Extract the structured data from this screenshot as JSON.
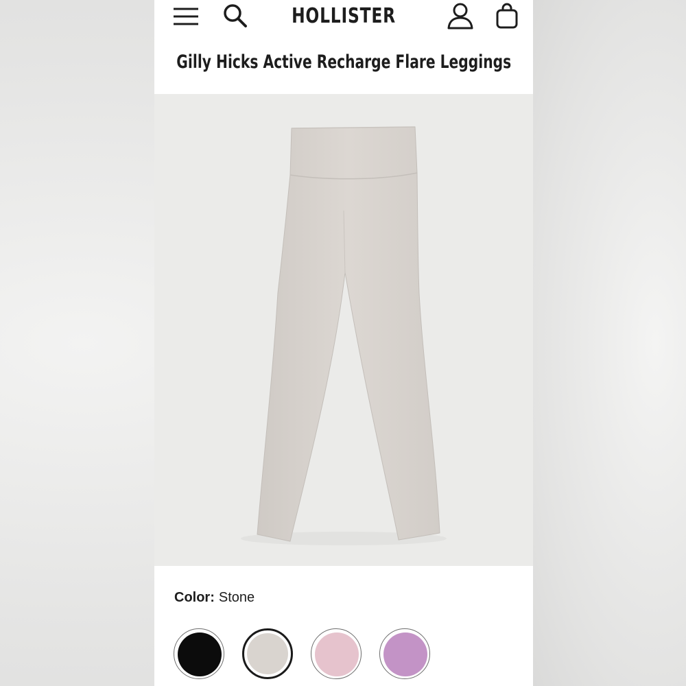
{
  "header": {
    "brand": "HOLLISTER",
    "icons": {
      "menu": "hamburger-menu-icon",
      "search": "search-icon",
      "account": "user-icon",
      "bag": "shopping-bag-icon"
    }
  },
  "product": {
    "title": "Gilly Hicks Active Recharge Flare Leggings",
    "image_color": "#d8d3ce"
  },
  "color_selector": {
    "label": "Color:",
    "selected_value": "Stone",
    "swatches": [
      {
        "name": "Black",
        "color": "#0c0c0c",
        "selected": false
      },
      {
        "name": "Stone",
        "color": "#d9d4cf",
        "selected": true
      },
      {
        "name": "Pink",
        "color": "#e6c3cd",
        "selected": false
      },
      {
        "name": "Purple",
        "color": "#c393c6",
        "selected": false
      }
    ]
  }
}
